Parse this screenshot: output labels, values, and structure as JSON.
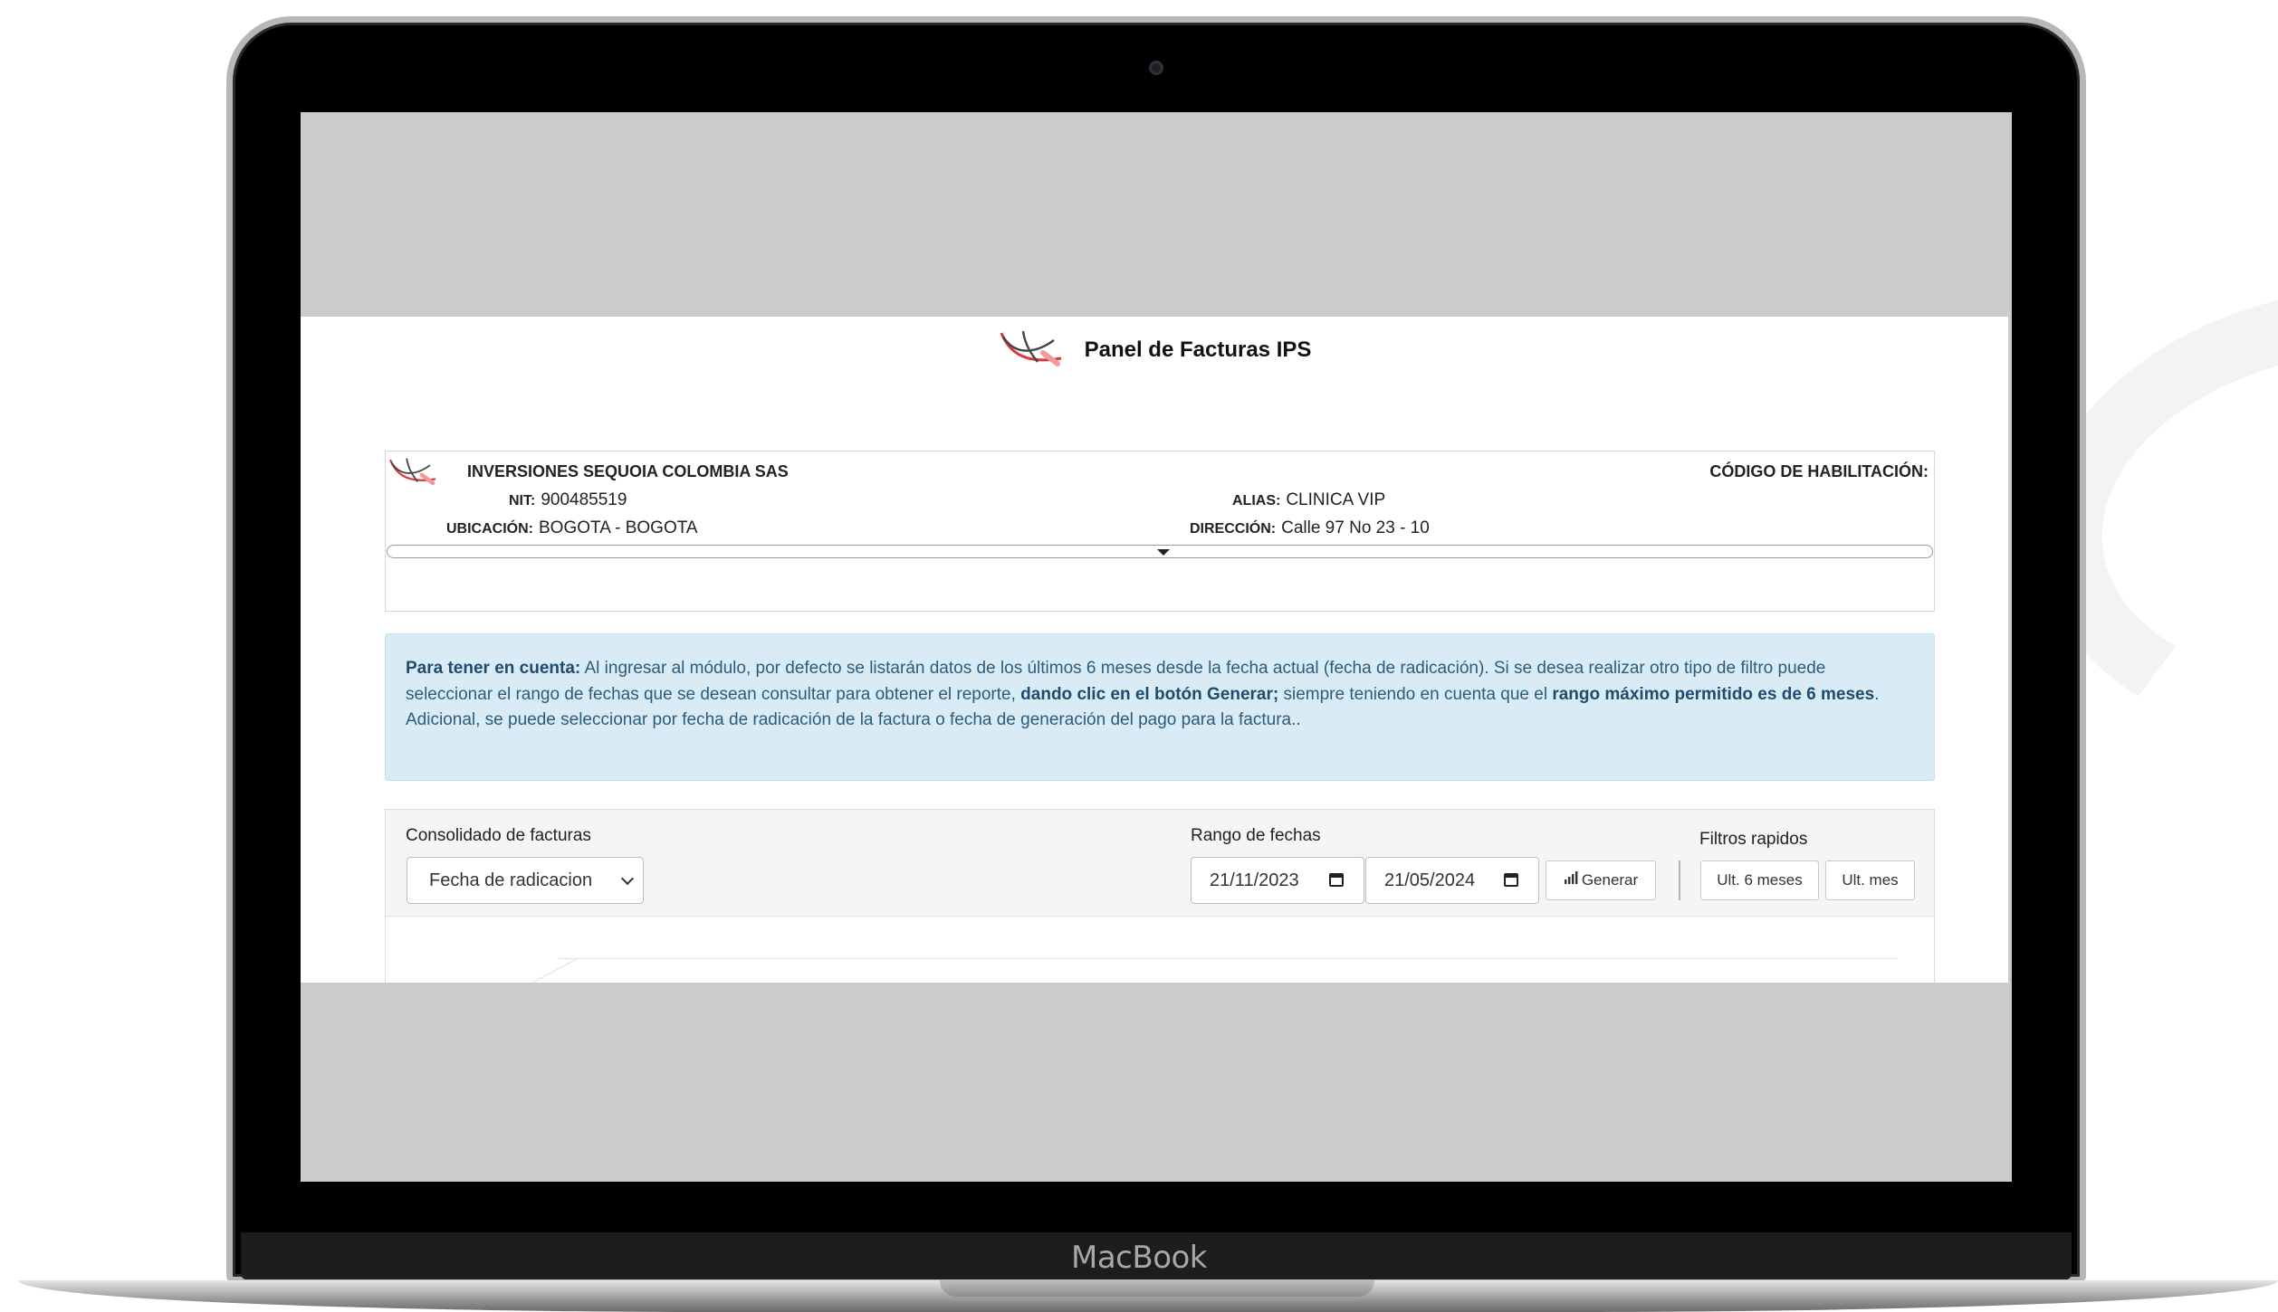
{
  "device": {
    "brand": "MacBook"
  },
  "header": {
    "title": "Panel de Facturas IPS"
  },
  "company": {
    "name": "INVERSIONES SEQUOIA COLOMBIA SAS",
    "habilitacion_label": "CÓDIGO DE HABILITACIÓN:",
    "nit_label": "NIT:",
    "nit": "900485519",
    "ubicacion_label": "UBICACIÓN:",
    "ubicacion": "BOGOTA - BOGOTA",
    "alias_label": "ALIAS:",
    "alias": "CLINICA VIP",
    "direccion_label": "DIRECCIÓN:",
    "direccion": "Calle 97 No 23 - 10"
  },
  "alert": {
    "strong_intro": "Para tener en cuenta:",
    "text1": " Al ingresar al módulo, por defecto se listarán datos de los últimos 6 meses desde la fecha actual (fecha de radicación). Si se desea realizar otro tipo de filtro puede seleccionar el rango de fechas que se desean consultar para obtener el reporte, ",
    "strong_generar": "dando clic en el botón Generar;",
    "text2": " siempre teniendo en cuenta que el ",
    "strong_rango": "rango máximo permitido es de 6 meses",
    "text3": ".",
    "line2": "Adicional, se puede seleccionar por fecha de radicación de la factura o fecha de generación del pago para la factura.."
  },
  "filters": {
    "consolidado_label": "Consolidado de facturas",
    "consolidado_value": "Fecha de radicacion",
    "rango_label": "Rango de fechas",
    "date_from": "21/11/2023",
    "date_to": "21/05/2024",
    "generar_label": "Generar",
    "filtros_label": "Filtros rapidos",
    "ult6_label": "Ult. 6 meses",
    "ult1_label": "Ult. mes"
  },
  "colors": {
    "alert_bg": "#d9ecf6",
    "alert_text": "#2c5c7c",
    "logo_red": "#d83a3a"
  }
}
